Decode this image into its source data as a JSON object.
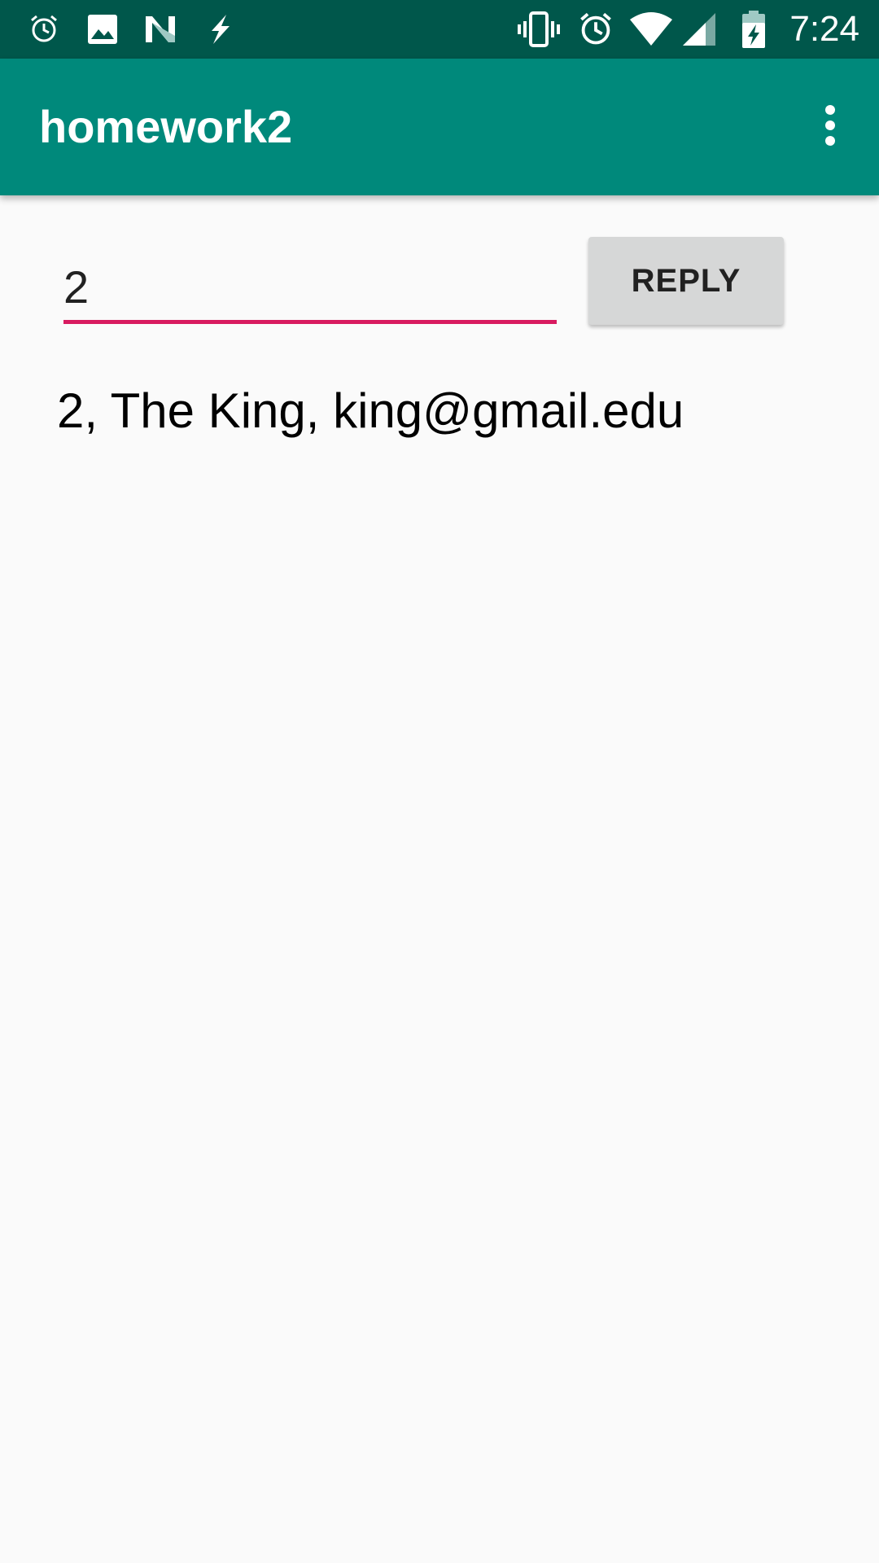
{
  "status_bar": {
    "time": "7:24",
    "left_icons": [
      "alarm-icon",
      "image-icon",
      "n-logo-icon",
      "flash-icon"
    ],
    "right_icons": [
      "vibrate-icon",
      "alarm-icon",
      "wifi-icon",
      "cell-signal-icon",
      "battery-charging-icon"
    ]
  },
  "app_bar": {
    "title": "homework2",
    "menu_icon": "more-vert-icon"
  },
  "form": {
    "input_value": "2",
    "reply_label": "REPLY"
  },
  "result": {
    "text": "2, The King, king@gmail.edu"
  },
  "colors": {
    "status_bar": "#00574b",
    "app_bar": "#00897b",
    "accent": "#d81b60",
    "background": "#fafafa",
    "button": "#d6d7d7"
  }
}
